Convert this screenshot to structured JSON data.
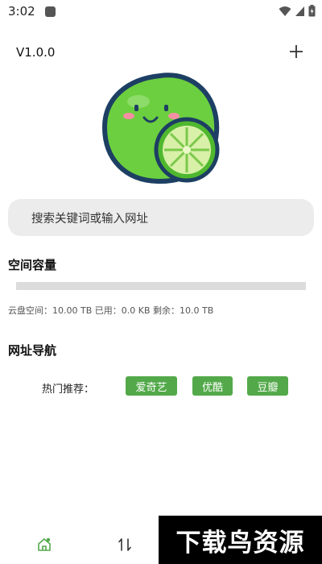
{
  "status_bar": {
    "time": "3:02"
  },
  "header": {
    "version": "V1.0.0"
  },
  "search": {
    "placeholder": "搜索关键词或输入网址"
  },
  "capacity": {
    "title": "空间容量",
    "used_fraction": 0.0,
    "info": "云盘空间：10.00 TB 已用：0.0 KB 剩余：10.0 TB"
  },
  "nav": {
    "title": "网址导航",
    "hot_label": "热门推荐：",
    "tags": [
      "爱奇艺",
      "优酷",
      "豆瓣"
    ]
  },
  "watermark": {
    "text": "下载鸟资源"
  },
  "colors": {
    "accent": "#53a94a",
    "logo_green": "#6ccf3f",
    "logo_outline": "#1d3f63"
  },
  "icons": [
    "wifi-icon",
    "signal-icon",
    "battery-icon",
    "plus-icon",
    "home-icon",
    "transfer-icon"
  ]
}
